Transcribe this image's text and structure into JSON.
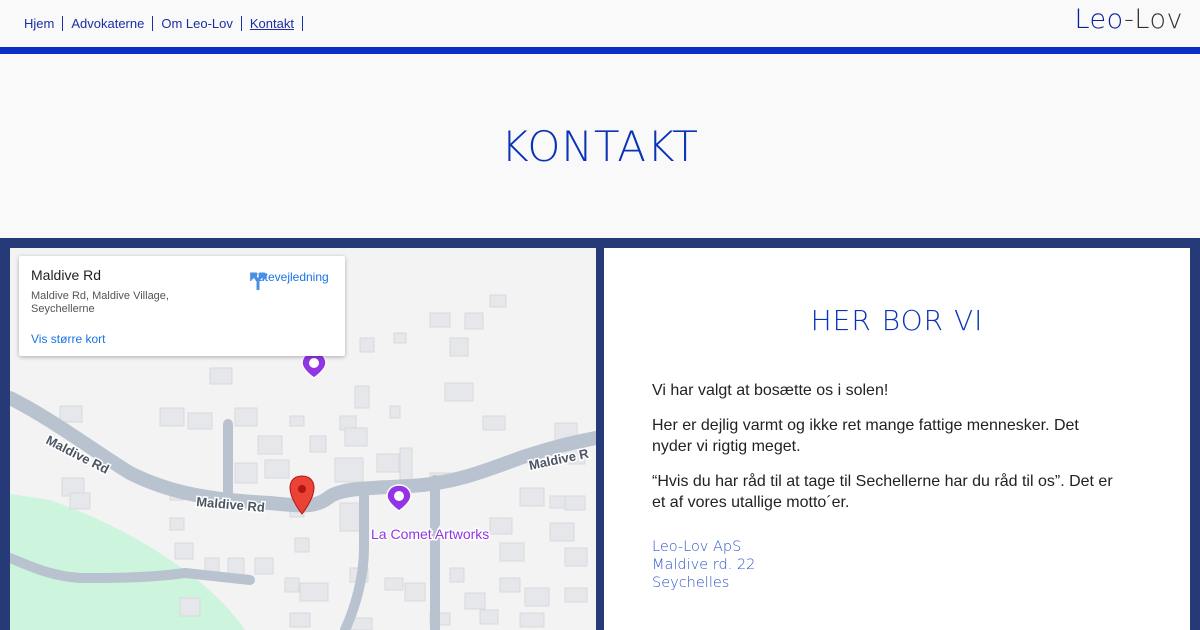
{
  "nav": {
    "items": [
      {
        "label": "Hjem"
      },
      {
        "label": "Advokaterne"
      },
      {
        "label": "Om Leo-Lov"
      },
      {
        "label": "Kontakt"
      }
    ]
  },
  "brand": {
    "part1": "Leo",
    "dash": "-",
    "part2": "Lov"
  },
  "page_title": "KONTAKT",
  "map": {
    "card": {
      "title": "Maldive Rd",
      "address": "Maldive Rd, Maldive Village, Seychellerne",
      "directions_label": "Rutevejledning",
      "larger_map_link": "Vis større kort"
    },
    "labels": {
      "road_1": "Maldive Rd",
      "road_2": "Maldive Rd",
      "road_3": "Maldive R",
      "poi": "La Comet Artworks"
    },
    "colors": {
      "road": "#b9c3d0",
      "park": "#cdf4dd",
      "poi": "#9334e6",
      "pin": "#ea4335"
    }
  },
  "panel": {
    "title": "HER BOR VI",
    "paragraphs": [
      "Vi har valgt at bosætte os i solen!",
      "Her er dejlig varmt og ikke ret mange fattige mennesker. Det nyder vi rigtig meget.",
      "“Hvis du har råd til at tage til Sechellerne har du råd til os”. Det er et af vores utallige motto´er."
    ],
    "address_lines": [
      "Leo-Lov ApS",
      "Maldive rd. 22",
      "Seychelles"
    ]
  }
}
